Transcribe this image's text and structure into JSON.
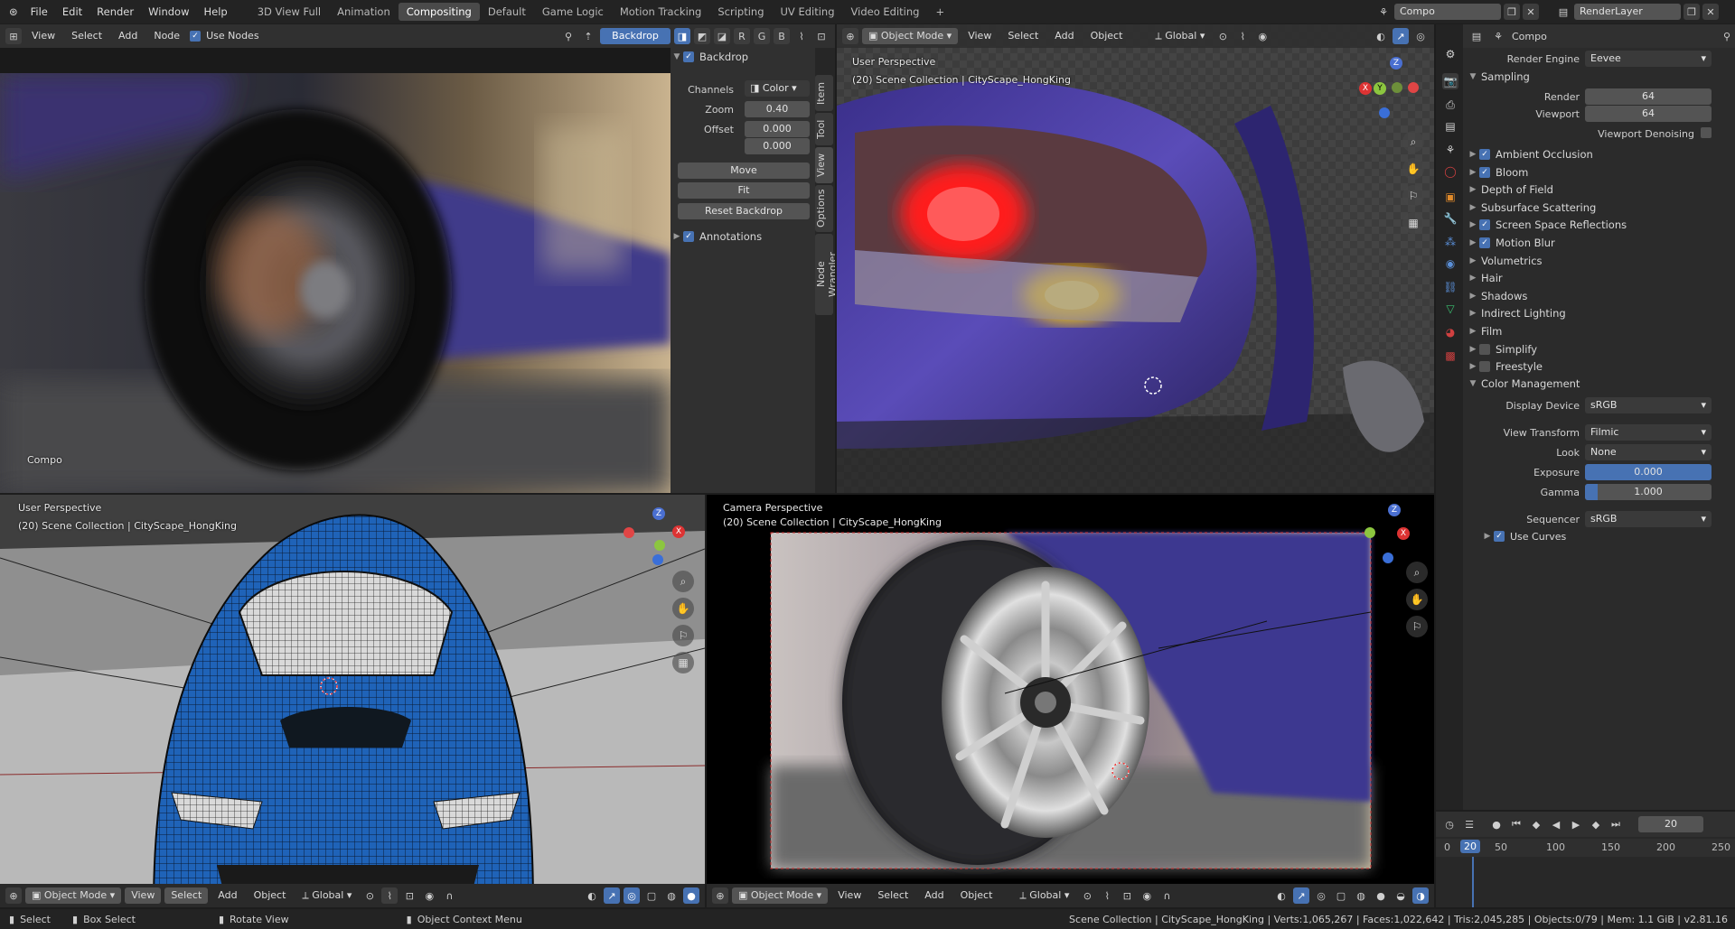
{
  "topbar": {
    "menus": [
      "File",
      "Edit",
      "Render",
      "Window",
      "Help"
    ],
    "workspaces": [
      "3D View Full",
      "Animation",
      "Compositing",
      "Default",
      "Game Logic",
      "Motion Tracking",
      "Scripting",
      "UV Editing",
      "Video Editing"
    ],
    "active_workspace": "Compositing",
    "scene_name": "Compo",
    "view_layer": "RenderLayer"
  },
  "compositor": {
    "menus": [
      "View",
      "Select",
      "Add",
      "Node"
    ],
    "use_nodes_label": "Use Nodes",
    "backdrop_button": "Backdrop",
    "channel_buttons": [
      "R",
      "G",
      "B"
    ],
    "image_label": "Compo",
    "sidebar": {
      "tabs": [
        "Item",
        "Tool",
        "View",
        "Options",
        "Node Wrangler"
      ],
      "backdrop_label": "Backdrop",
      "channels_label": "Channels",
      "channels_value": "Color",
      "zoom_label": "Zoom",
      "zoom_value": "0.40",
      "offset_label": "Offset",
      "offset_x": "0.000",
      "offset_y": "0.000",
      "move_button": "Move",
      "fit_button": "Fit",
      "reset_button": "Reset Backdrop",
      "annotations_label": "Annotations"
    }
  },
  "viewport_top_right": {
    "mode": "Object Mode",
    "menus": [
      "View",
      "Select",
      "Add",
      "Object"
    ],
    "orientation": "Global",
    "perspective": "User Perspective",
    "collection": "(20) Scene Collection | CityScape_HongKing"
  },
  "viewport_bottom_left": {
    "mode": "Object Mode",
    "menus": [
      "View",
      "Select",
      "Add",
      "Object"
    ],
    "orientation": "Global",
    "perspective": "User Perspective",
    "collection": "(20) Scene Collection | CityScape_HongKing"
  },
  "viewport_bottom_right": {
    "mode": "Object Mode",
    "menus": [
      "View",
      "Select",
      "Add",
      "Object"
    ],
    "orientation": "Global",
    "perspective": "Camera Perspective",
    "collection": "(20) Scene Collection | CityScape_HongKing"
  },
  "gizmo_axes": {
    "x": "X",
    "y": "Y",
    "z": "Z"
  },
  "properties": {
    "header_title": "Compo",
    "render_engine_label": "Render Engine",
    "render_engine_value": "Eevee",
    "sampling_label": "Sampling",
    "render_label": "Render",
    "render_value": "64",
    "viewport_label": "Viewport",
    "viewport_value": "64",
    "viewport_denoising_label": "Viewport Denoising",
    "panels": [
      {
        "label": "Ambient Occlusion",
        "checkbox": true,
        "checked": true
      },
      {
        "label": "Bloom",
        "checkbox": true,
        "checked": true
      },
      {
        "label": "Depth of Field",
        "checkbox": false,
        "checked": false
      },
      {
        "label": "Subsurface Scattering",
        "checkbox": false,
        "checked": false
      },
      {
        "label": "Screen Space Reflections",
        "checkbox": true,
        "checked": true
      },
      {
        "label": "Motion Blur",
        "checkbox": true,
        "checked": true
      },
      {
        "label": "Volumetrics",
        "checkbox": false,
        "checked": false
      },
      {
        "label": "Hair",
        "checkbox": false,
        "checked": false
      },
      {
        "label": "Shadows",
        "checkbox": false,
        "checked": false
      },
      {
        "label": "Indirect Lighting",
        "checkbox": false,
        "checked": false
      },
      {
        "label": "Film",
        "checkbox": false,
        "checked": false
      },
      {
        "label": "Simplify",
        "checkbox": true,
        "checked": false
      },
      {
        "label": "Freestyle",
        "checkbox": true,
        "checked": false
      }
    ],
    "color_management_label": "Color Management",
    "display_device_label": "Display Device",
    "display_device_value": "sRGB",
    "view_transform_label": "View Transform",
    "view_transform_value": "Filmic",
    "look_label": "Look",
    "look_value": "None",
    "exposure_label": "Exposure",
    "exposure_value": "0.000",
    "gamma_label": "Gamma",
    "gamma_value": "1.000",
    "gamma_fraction": 0.1,
    "sequencer_label": "Sequencer",
    "sequencer_value": "sRGB",
    "use_curves_label": "Use Curves"
  },
  "timeline": {
    "current_frame": "20",
    "ticks": [
      "0",
      "20",
      "50",
      "100",
      "150",
      "200",
      "250"
    ]
  },
  "statusbar": {
    "select": "Select",
    "box_select": "Box Select",
    "rotate_view": "Rotate View",
    "context_menu": "Object Context Menu",
    "stats": "Scene Collection | CityScape_HongKing | Verts:1,065,267 | Faces:1,022,642 | Tris:2,045,285 | Objects:0/79 | Mem: 1.1 GiB | v2.81.16"
  },
  "colors": {
    "accent": "#4772b3",
    "panel": "#303030",
    "background": "#1d1d1d"
  }
}
